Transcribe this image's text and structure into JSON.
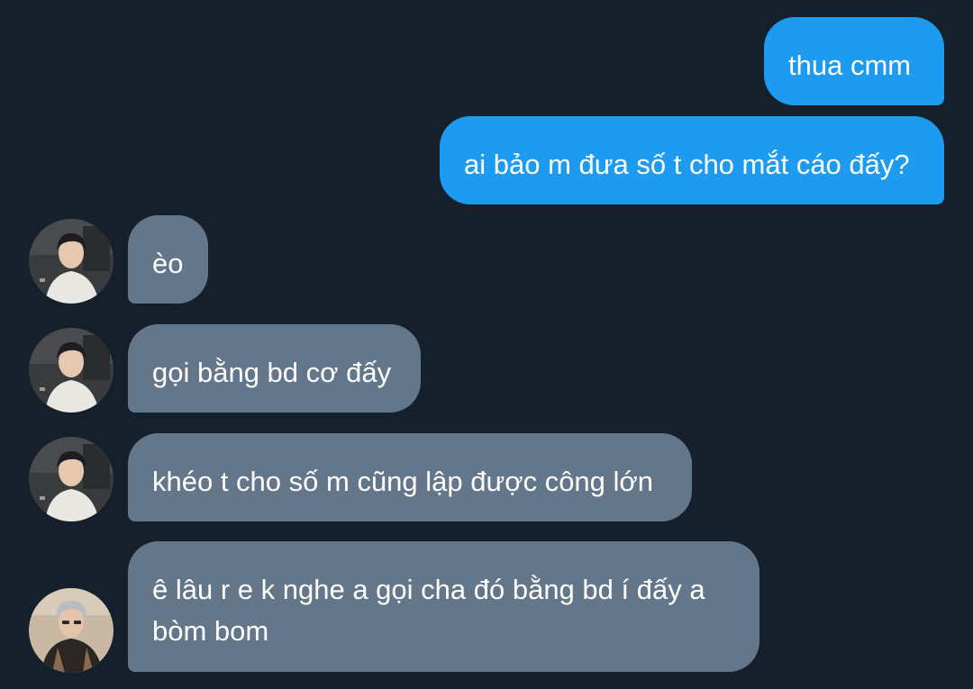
{
  "colors": {
    "background": "#16202c",
    "sent_bubble": "#1d9bf0",
    "received_bubble": "#64768a",
    "text": "#ffffff"
  },
  "messages": [
    {
      "direction": "sent",
      "text": "thua cmm"
    },
    {
      "direction": "sent",
      "text": "ai bảo m đưa số t cho mắt cáo đấy?"
    },
    {
      "direction": "received",
      "avatar": "avatar-boy-white-shirt",
      "text": "èo"
    },
    {
      "direction": "received",
      "avatar": "avatar-boy-white-shirt",
      "text": "gọi bằng bd cơ đấy"
    },
    {
      "direction": "received",
      "avatar": "avatar-boy-white-shirt",
      "text": "khéo t cho số m cũng lập được công lớn"
    },
    {
      "direction": "received",
      "avatar": "avatar-boy-grey-hair",
      "text_lines": [
        "ê lâu r e k nghe a gọi cha đó bằng bd í đấy a",
        "bòm bom"
      ]
    }
  ]
}
